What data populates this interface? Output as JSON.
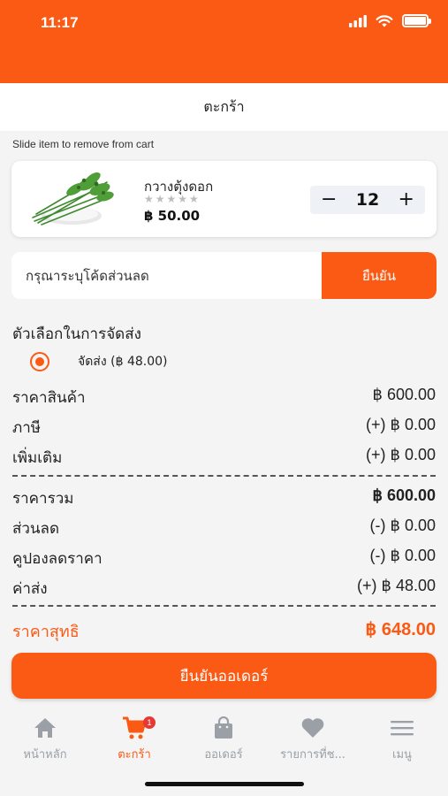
{
  "status_bar": {
    "time": "11:17"
  },
  "header": {
    "title": "ตะกร้า"
  },
  "cart": {
    "hint": "Slide item to remove from cart",
    "item": {
      "name": "กวางตุ้งดอก",
      "stars": "★★★★★",
      "rating_filled": 0,
      "price": "฿ 50.00",
      "minus": "−",
      "quantity": "12",
      "plus": "+"
    }
  },
  "coupon": {
    "placeholder": "กรุณาระบุโค้ดส่วนลด",
    "button": "ยืนยัน"
  },
  "delivery": {
    "title": "ตัวเลือกในการจัดส่ง",
    "option": "จัดส่ง (฿ 48.00)"
  },
  "summary": {
    "subtotal": {
      "label": "ราคาสินค้า",
      "value": "฿ 600.00"
    },
    "tax": {
      "label": "ภาษี",
      "value": "(+) ฿ 0.00"
    },
    "extra": {
      "label": "เพิ่มเติม",
      "value": "(+) ฿ 0.00"
    },
    "total": {
      "label": "ราคารวม",
      "value": "฿ 600.00"
    },
    "discount": {
      "label": "ส่วนลด",
      "value": "(-) ฿ 0.00"
    },
    "coupon": {
      "label": "คูปองลดราคา",
      "value": "(-) ฿ 0.00"
    },
    "shipping": {
      "label": "ค่าส่ง",
      "value": "(+) ฿ 48.00"
    },
    "net": {
      "label": "ราคาสุทธิ",
      "value": "฿ 648.00"
    }
  },
  "confirm_order": "ยืนยันออเดอร์",
  "tabs": [
    {
      "label": "หน้าหลัก",
      "icon": "home-icon"
    },
    {
      "label": "ตะกร้า",
      "icon": "cart-icon",
      "badge": "1"
    },
    {
      "label": "ออเดอร์",
      "icon": "bag-icon"
    },
    {
      "label": "รายการที่ช...",
      "icon": "heart-icon"
    },
    {
      "label": "เมนู",
      "icon": "menu-icon"
    }
  ],
  "colors": {
    "accent": "#fa5a14",
    "badge": "#e53935",
    "inactive": "#9aa0a6"
  }
}
